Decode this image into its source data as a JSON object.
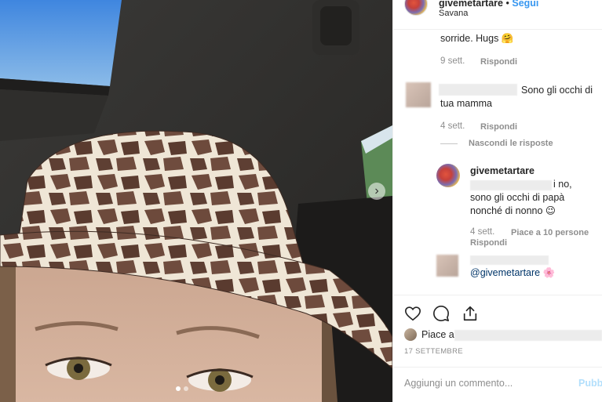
{
  "post": {
    "username": "givemetartare",
    "separator": "•",
    "follow_label": "Segui",
    "location": "Savana"
  },
  "comments": {
    "first": {
      "text_tail": "sorride. Hugs 🤗",
      "time": "9 sett.",
      "reply_label": "Rispondi"
    },
    "second": {
      "text": "Sono gli occhi di tua mamma",
      "time": "4 sett.",
      "reply_label": "Rispondi",
      "hide_replies_label": "Nascondi le risposte"
    },
    "reply": {
      "username": "givemetartare",
      "text": "i no, sono gli occhi di papà nonché di nonno 😉",
      "time": "4 sett.",
      "likes_label": "Piace a 10 persone",
      "reply_label": "Rispondi"
    },
    "third": {
      "mention": "@givemetartare",
      "emoji": "🌸"
    }
  },
  "actions": {
    "like_icon": "heart-icon",
    "comment_icon": "comment-icon",
    "share_icon": "share-icon",
    "likes_prefix": "Piace a",
    "date": "17 SETTEMBRE"
  },
  "composer": {
    "placeholder": "Aggiungi un commento...",
    "publish_label": "Pubb"
  },
  "colors": {
    "link_blue": "#3897f0",
    "muted_gray": "#8e8e8e",
    "text": "#262626"
  }
}
